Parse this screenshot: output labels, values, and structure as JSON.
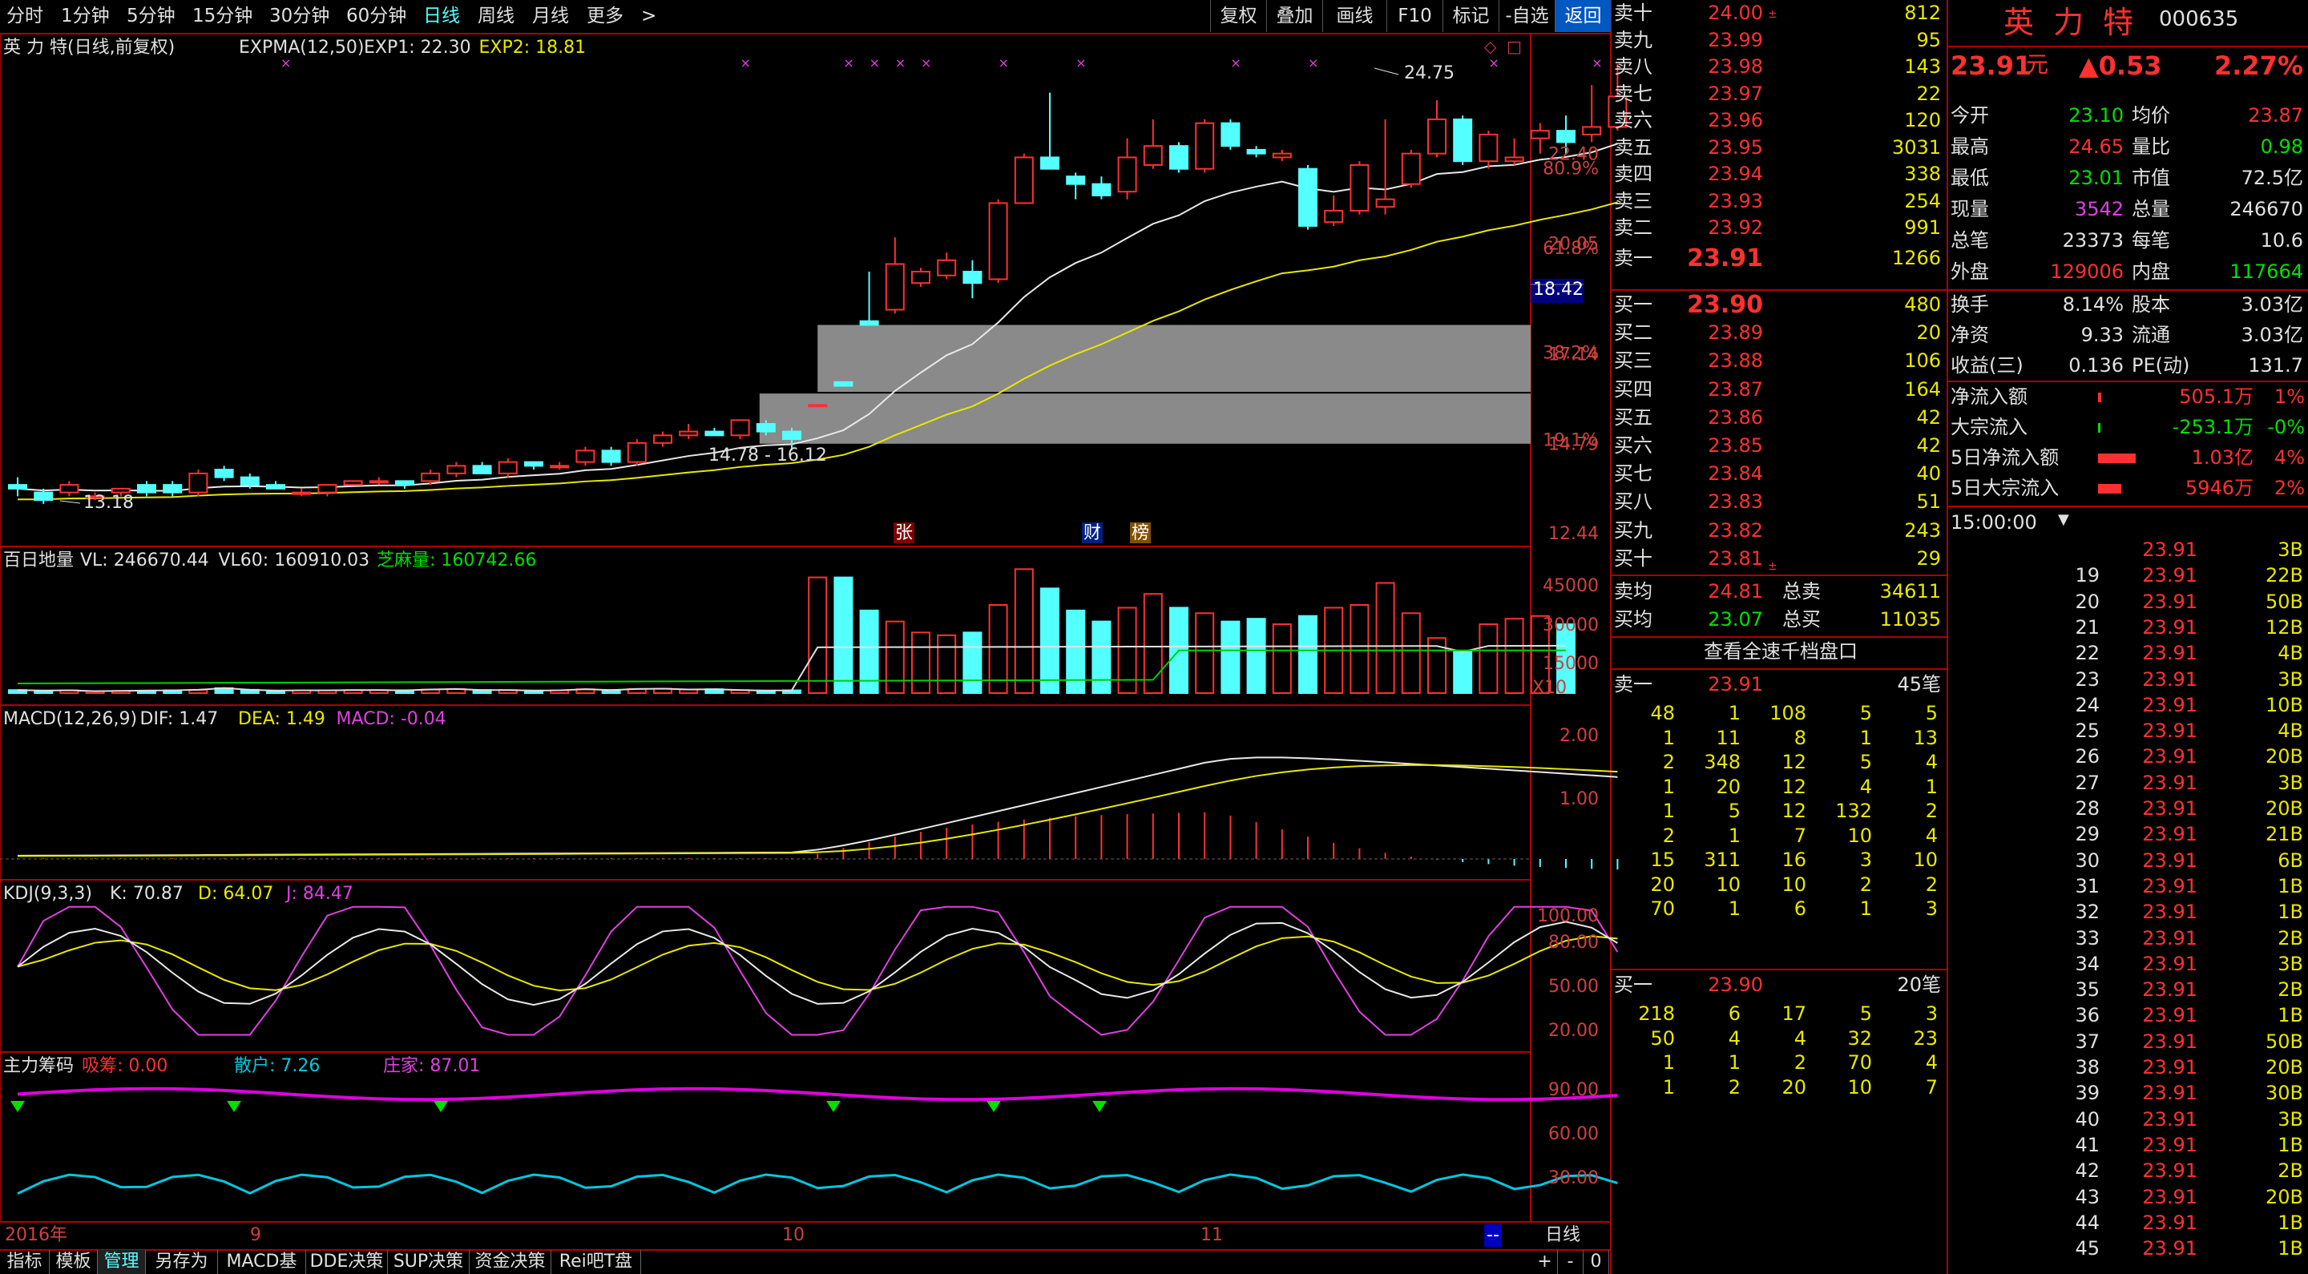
{
  "toolbar": {
    "periods": [
      "分时",
      "1分钟",
      "5分钟",
      "15分钟",
      "30分钟",
      "60分钟",
      "日线",
      "周线",
      "月线",
      "更多"
    ],
    "more_arrow": ">",
    "right_buttons": [
      "复权",
      "叠加",
      "画线",
      "F10",
      "标记",
      "-自选",
      "返回"
    ]
  },
  "main_pane": {
    "title": "英 力 特(日线,前复权)",
    "indicator": "EXPMA(12,50)",
    "exp1": "EXP1: 22.30",
    "exp2": "EXP2: 18.81",
    "price_labels": [
      "22.40",
      "20.05",
      "17.14",
      "14.79",
      "12.44"
    ],
    "pct_labels": [
      "80.9%",
      "61.8%",
      "38.2%",
      "19.1%"
    ],
    "current_price_tag": "18.42",
    "high_mark": "24.75",
    "low_mark": "13.18",
    "range_label": "14.78 - 16.12",
    "event_marks": [
      "张",
      "财",
      "榜"
    ]
  },
  "volume_pane": {
    "title": "百日地量",
    "vl": "VL: 246670.44",
    "vl60": "VL60: 160910.03",
    "sesame": "芝麻量: 160742.66",
    "axis": [
      "45000",
      "30000",
      "15000"
    ],
    "unit": "X10"
  },
  "macd_pane": {
    "title": "MACD(12,26,9)",
    "dif": "DIF: 1.47",
    "dea": "DEA: 1.49",
    "macd": "MACD: -0.04",
    "axis": [
      "2.00",
      "1.00"
    ]
  },
  "kdj_pane": {
    "title": "KDJ(9,3,3)",
    "k": "K: 70.87",
    "d": "D: 64.07",
    "j": "J: 84.47",
    "axis": [
      "100.00",
      "80.00",
      "50.00",
      "20.00"
    ]
  },
  "chips_pane": {
    "title": "主力筹码",
    "xichou": "吸筹: 0.00",
    "sanhu": "散户: 7.26",
    "zhuangjia": "庄家: 87.01",
    "axis": [
      "90.00",
      "60.00",
      "30.00"
    ]
  },
  "date_axis": [
    "2016年",
    "9",
    "10",
    "11"
  ],
  "bottom_tabs": [
    "指标",
    "模板",
    "管理",
    "另存为",
    "MACD基本",
    "DDE决策",
    "SUP决策",
    "资金决策",
    "Rei吧T盘"
  ],
  "period_badge": "日线",
  "scroll_buttons": [
    "+",
    "-",
    "0"
  ],
  "quote": {
    "sell": [
      {
        "label": "卖十",
        "price": "24.00",
        "vol": "812"
      },
      {
        "label": "卖九",
        "price": "23.99",
        "vol": "95"
      },
      {
        "label": "卖八",
        "price": "23.98",
        "vol": "143"
      },
      {
        "label": "卖七",
        "price": "23.97",
        "vol": "22"
      },
      {
        "label": "卖六",
        "price": "23.96",
        "vol": "120"
      },
      {
        "label": "卖五",
        "price": "23.95",
        "vol": "3031"
      },
      {
        "label": "卖四",
        "price": "23.94",
        "vol": "338"
      },
      {
        "label": "卖三",
        "price": "23.93",
        "vol": "254"
      },
      {
        "label": "卖二",
        "price": "23.92",
        "vol": "991"
      },
      {
        "label": "卖一",
        "price": "23.91",
        "vol": "1266"
      }
    ],
    "buy": [
      {
        "label": "买一",
        "price": "23.90",
        "vol": "480"
      },
      {
        "label": "买二",
        "price": "23.89",
        "vol": "20"
      },
      {
        "label": "买三",
        "price": "23.88",
        "vol": "106"
      },
      {
        "label": "买四",
        "price": "23.87",
        "vol": "164"
      },
      {
        "label": "买五",
        "price": "23.86",
        "vol": "42"
      },
      {
        "label": "买六",
        "price": "23.85",
        "vol": "42"
      },
      {
        "label": "买七",
        "price": "23.84",
        "vol": "40"
      },
      {
        "label": "买八",
        "price": "23.83",
        "vol": "51"
      },
      {
        "label": "买九",
        "price": "23.82",
        "vol": "243"
      },
      {
        "label": "买十",
        "price": "23.81",
        "vol": "29"
      }
    ],
    "avg": [
      {
        "label": "卖均",
        "price": "24.81",
        "tl": "总卖",
        "tv": "34611"
      },
      {
        "label": "买均",
        "price": "23.07",
        "tl": "总买",
        "tv": "11035"
      }
    ],
    "view_all": "查看全速千档盘口",
    "sell1_queue": {
      "label": "卖一",
      "price": "23.91",
      "count": "45笔",
      "rows": [
        [
          "48",
          "1",
          "108",
          "5",
          "5"
        ],
        [
          "1",
          "11",
          "8",
          "1",
          "13"
        ],
        [
          "2",
          "348",
          "12",
          "5",
          "4"
        ],
        [
          "1",
          "20",
          "12",
          "4",
          "1"
        ],
        [
          "1",
          "5",
          "12",
          "132",
          "2"
        ],
        [
          "2",
          "1",
          "7",
          "10",
          "4"
        ],
        [
          "15",
          "311",
          "16",
          "3",
          "10"
        ],
        [
          "20",
          "10",
          "10",
          "2",
          "2"
        ],
        [
          "70",
          "1",
          "6",
          "1",
          "3"
        ]
      ]
    },
    "buy1_queue": {
      "label": "买一",
      "price": "23.90",
      "count": "20笔",
      "rows": [
        [
          "218",
          "6",
          "17",
          "5",
          "3"
        ],
        [
          "50",
          "4",
          "4",
          "32",
          "23"
        ],
        [
          "1",
          "1",
          "2",
          "70",
          "4"
        ],
        [
          "1",
          "2",
          "20",
          "10",
          "7"
        ]
      ]
    }
  },
  "info": {
    "name": "英 力 特",
    "code": "000635",
    "price": "23.91",
    "price_unit": "元",
    "change": "▲0.53",
    "pct": "2.27%",
    "rows": [
      [
        {
          "l": "今开",
          "v": "23.10",
          "c": "#00e000"
        },
        {
          "l": "均价",
          "v": "23.87",
          "c": "#ff3030"
        }
      ],
      [
        {
          "l": "最高",
          "v": "24.65",
          "c": "#ff3030"
        },
        {
          "l": "量比",
          "v": "0.98",
          "c": "#00e000"
        }
      ],
      [
        {
          "l": "最低",
          "v": "23.01",
          "c": "#00e000"
        },
        {
          "l": "市值",
          "v": "72.5亿",
          "c": "#e0e0e0"
        }
      ],
      [
        {
          "l": "现量",
          "v": "3542",
          "c": "#e040e0"
        },
        {
          "l": "总量",
          "v": "246670",
          "c": "#e0e0e0"
        }
      ],
      [
        {
          "l": "总笔",
          "v": "23373",
          "c": "#e0e0e0"
        },
        {
          "l": "每笔",
          "v": "10.6",
          "c": "#e0e0e0"
        }
      ],
      [
        {
          "l": "外盘",
          "v": "129006",
          "c": "#ff3030"
        },
        {
          "l": "内盘",
          "v": "117664",
          "c": "#00e000"
        }
      ]
    ],
    "rows2": [
      [
        {
          "l": "换手",
          "v": "8.14%"
        },
        {
          "l": "股本",
          "v": "3.03亿"
        }
      ],
      [
        {
          "l": "净资",
          "v": "9.33"
        },
        {
          "l": "流通",
          "v": "3.03亿"
        }
      ],
      [
        {
          "l": "收益(三)",
          "v": "0.136"
        },
        {
          "l": "PE(动)",
          "v": "131.7"
        }
      ]
    ],
    "flows": [
      {
        "l": "净流入额",
        "v": "505.1万",
        "p": "1%",
        "c": "#ff3030",
        "bar": 0.08
      },
      {
        "l": "大宗流入",
        "v": "-253.1万",
        "p": "-0%",
        "c": "#00e000",
        "bar": 0.04
      },
      {
        "l": "5日净流入额",
        "v": "1.03亿",
        "p": "4%",
        "c": "#ff3030",
        "bar": 0.9
      },
      {
        "l": "5日大宗流入",
        "v": "5946万",
        "p": "2%",
        "c": "#ff3030",
        "bar": 0.55
      }
    ],
    "tick_header": "15:00:00",
    "ticks": [
      [
        "",
        "23.91",
        "3B"
      ],
      [
        "19",
        "23.91",
        "22B"
      ],
      [
        "20",
        "23.91",
        "50B"
      ],
      [
        "21",
        "23.91",
        "12B"
      ],
      [
        "22",
        "23.91",
        "4B"
      ],
      [
        "23",
        "23.91",
        "3B"
      ],
      [
        "24",
        "23.91",
        "10B"
      ],
      [
        "25",
        "23.91",
        "4B"
      ],
      [
        "26",
        "23.91",
        "20B"
      ],
      [
        "27",
        "23.91",
        "3B"
      ],
      [
        "28",
        "23.91",
        "20B"
      ],
      [
        "29",
        "23.91",
        "21B"
      ],
      [
        "30",
        "23.91",
        "6B"
      ],
      [
        "31",
        "23.91",
        "1B"
      ],
      [
        "32",
        "23.91",
        "1B"
      ],
      [
        "33",
        "23.91",
        "2B"
      ],
      [
        "34",
        "23.91",
        "3B"
      ],
      [
        "35",
        "23.91",
        "2B"
      ],
      [
        "36",
        "23.91",
        "1B"
      ],
      [
        "37",
        "23.91",
        "50B"
      ],
      [
        "38",
        "23.91",
        "20B"
      ],
      [
        "39",
        "23.91",
        "30B"
      ],
      [
        "40",
        "23.91",
        "3B"
      ],
      [
        "41",
        "23.91",
        "1B"
      ],
      [
        "42",
        "23.91",
        "2B"
      ],
      [
        "43",
        "23.91",
        "20B"
      ],
      [
        "44",
        "23.91",
        "1B"
      ],
      [
        "45",
        "23.91",
        "1B"
      ]
    ]
  },
  "chart_data": {
    "type": "candlestick",
    "y_range": [
      12.44,
      24.75
    ],
    "candles": [
      [
        13.7,
        13.6,
        13.9,
        13.4
      ],
      [
        13.5,
        13.3,
        13.6,
        13.2
      ],
      [
        13.5,
        13.7,
        13.8,
        13.4
      ],
      [
        13.4,
        13.4,
        13.5,
        13.3
      ],
      [
        13.5,
        13.6,
        13.6,
        13.4
      ],
      [
        13.7,
        13.5,
        13.8,
        13.4
      ],
      [
        13.7,
        13.5,
        13.8,
        13.4
      ],
      [
        13.5,
        14.0,
        14.1,
        13.4
      ],
      [
        14.1,
        13.9,
        14.2,
        13.8
      ],
      [
        13.9,
        13.7,
        14.0,
        13.6
      ],
      [
        13.7,
        13.6,
        13.8,
        13.6
      ],
      [
        13.5,
        13.5,
        13.6,
        13.4
      ],
      [
        13.5,
        13.7,
        13.7,
        13.4
      ],
      [
        13.7,
        13.8,
        13.8,
        13.7
      ],
      [
        13.8,
        13.8,
        13.9,
        13.7
      ],
      [
        13.8,
        13.7,
        13.8,
        13.6
      ],
      [
        13.8,
        14.0,
        14.1,
        13.7
      ],
      [
        14.0,
        14.2,
        14.3,
        13.9
      ],
      [
        14.2,
        14.0,
        14.3,
        14.0
      ],
      [
        14.0,
        14.3,
        14.4,
        13.9
      ],
      [
        14.3,
        14.2,
        14.3,
        14.1
      ],
      [
        14.2,
        14.2,
        14.3,
        14.1
      ],
      [
        14.3,
        14.6,
        14.7,
        14.2
      ],
      [
        14.6,
        14.3,
        14.7,
        14.2
      ],
      [
        14.3,
        14.8,
        14.9,
        14.2
      ],
      [
        14.8,
        15.0,
        15.1,
        14.7
      ],
      [
        15.0,
        15.1,
        15.3,
        14.9
      ],
      [
        15.1,
        15.0,
        15.2,
        15.0
      ],
      [
        15.0,
        15.4,
        15.4,
        14.9
      ],
      [
        15.3,
        15.1,
        15.4,
        15.0
      ],
      [
        15.1,
        14.9,
        15.2,
        14.6
      ],
      [
        15.8,
        15.8,
        15.8,
        15.8
      ],
      [
        16.4,
        16.3,
        16.4,
        16.3
      ],
      [
        18.0,
        17.9,
        19.3,
        17.9
      ],
      [
        18.3,
        19.5,
        20.2,
        18.2
      ],
      [
        19.0,
        19.3,
        19.4,
        18.9
      ],
      [
        19.2,
        19.6,
        19.8,
        19.1
      ],
      [
        19.3,
        19.0,
        19.6,
        18.6
      ],
      [
        19.1,
        21.1,
        21.2,
        19.0
      ],
      [
        21.1,
        22.3,
        22.4,
        21.1
      ],
      [
        22.3,
        22.0,
        24.0,
        22.0
      ],
      [
        21.8,
        21.6,
        21.9,
        21.2
      ],
      [
        21.6,
        21.3,
        21.8,
        21.2
      ],
      [
        21.4,
        22.3,
        22.8,
        21.2
      ],
      [
        22.1,
        22.6,
        23.3,
        22.0
      ],
      [
        22.6,
        22.0,
        22.7,
        21.9
      ],
      [
        22.0,
        23.2,
        23.3,
        21.9
      ],
      [
        23.2,
        22.6,
        23.3,
        22.5
      ],
      [
        22.5,
        22.4,
        22.6,
        22.3
      ],
      [
        22.3,
        22.4,
        22.5,
        22.2
      ],
      [
        22.0,
        20.5,
        22.1,
        20.4
      ],
      [
        20.6,
        20.9,
        21.3,
        20.5
      ],
      [
        20.9,
        22.1,
        22.2,
        20.8
      ],
      [
        21.0,
        21.2,
        23.3,
        20.8
      ],
      [
        21.6,
        22.4,
        22.5,
        21.5
      ],
      [
        22.4,
        23.3,
        23.8,
        22.3
      ],
      [
        23.3,
        22.2,
        23.4,
        22.1
      ],
      [
        22.2,
        22.9,
        23.0,
        22.0
      ],
      [
        22.2,
        22.3,
        22.8,
        22.1
      ],
      [
        22.8,
        23.0,
        23.2,
        22.4
      ],
      [
        23.0,
        22.7,
        23.4,
        22.4
      ],
      [
        22.9,
        23.1,
        24.2,
        22.7
      ],
      [
        23.1,
        23.9,
        24.75,
        23.0
      ]
    ],
    "exp1_line_end": 22.3,
    "exp2_line_end": 18.81,
    "volume": [
      1100,
      900,
      1000,
      700,
      800,
      900,
      1000,
      1200,
      1800,
      1200,
      900,
      1000,
      1000,
      1100,
      1100,
      1000,
      1300,
      1500,
      1100,
      1100,
      900,
      1000,
      1400,
      1100,
      1500,
      1600,
      1300,
      1400,
      1100,
      900,
      1000,
      42000,
      42000,
      30000,
      26000,
      22000,
      21000,
      22000,
      32000,
      45000,
      38000,
      30000,
      26000,
      31000,
      36000,
      31000,
      29000,
      26000,
      27000,
      25000,
      28000,
      31000,
      32000,
      40000,
      29000,
      20000,
      15000,
      25000,
      27000,
      28000,
      25000
    ],
    "kdj": {
      "k": 70.87,
      "d": 64.07,
      "j": 84.47
    },
    "macd": {
      "dif": 1.47,
      "dea": 1.49,
      "macd": -0.04
    }
  }
}
